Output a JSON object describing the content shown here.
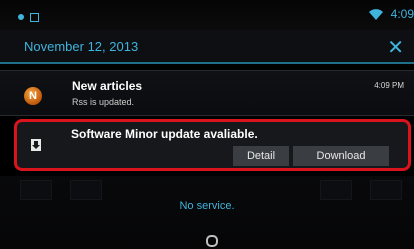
{
  "status_bar": {
    "time": "4:09",
    "left_icons": [
      "notification-dot-icon",
      "sd-card-icon"
    ],
    "right_icons": [
      "wifi-icon"
    ]
  },
  "header": {
    "date": "November 12, 2013",
    "close_label": "✕"
  },
  "notifications": [
    {
      "icon": "news-icon",
      "icon_letter": "N",
      "title": "New articles",
      "subtitle": "Rss is updated.",
      "time": "4:09 PM"
    },
    {
      "icon": "download-icon",
      "title": "Software Minor update avaliable.",
      "actions": [
        "Detail",
        "Download"
      ]
    }
  ],
  "footer": {
    "status": "No service.",
    "home_icon": "home-ring-icon"
  },
  "colors": {
    "accent": "#3fb4dc",
    "highlight_border": "#d9141c",
    "button_bg": "#3a3d42",
    "news_icon": "#e07a1a"
  }
}
